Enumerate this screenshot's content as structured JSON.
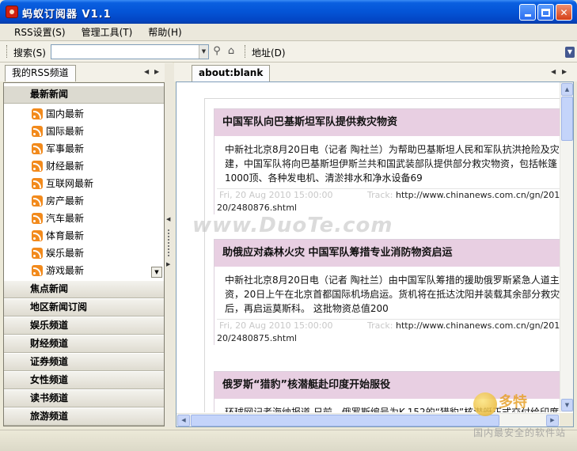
{
  "window": {
    "title": "蚂蚁订阅器  V1.1",
    "controls": {
      "minimize": "minimize",
      "maximize": "maximize",
      "close": "✕"
    }
  },
  "menu": [
    "RSS设置(S)",
    "管理工具(T)",
    "帮助(H)"
  ],
  "toolbar": {
    "search_label": "搜索(S)",
    "search_value": "",
    "address_label": "地址(D)"
  },
  "left_panel": {
    "tab": "我的RSS频道",
    "active_group": "最新新闻",
    "feeds": [
      "国内最新",
      "国际最新",
      "军事最新",
      "财经最新",
      "互联网最新",
      "房产最新",
      "汽车最新",
      "体育最新",
      "娱乐最新",
      "游戏最新"
    ],
    "groups": [
      "焦点新闻",
      "地区新闻订阅",
      "娱乐频道",
      "财经频道",
      "证券频道",
      "女性频道",
      "读书频道",
      "旅游频道"
    ]
  },
  "browser": {
    "tab": "about:blank",
    "articles": [
      {
        "title": "中国军队向巴基斯坦军队提供救灾物资",
        "body": [
          "中新社北京8月20日电（记者 陶社兰）为帮助巴基斯坦人民和军队抗洪抢险及灾后重",
          "建，中国军队将向巴基斯坦伊斯兰共和国武装部队提供部分救灾物资，包括帐篷",
          "1000顶、各种发电机、清淤排水和净水设备69"
        ],
        "meta_date": "Fri, 20 Aug 2010 15:00:00",
        "meta_track": "Track:",
        "link_a": "http://www.chinanews.com.cn/gn/2010/08-",
        "link_b": "20/2480876.shtml"
      },
      {
        "title": "助俄应对森林火灾  中国军队筹措专业消防物资启运",
        "body": [
          "中新社北京8月20日电（记者 陶社兰）由中国军队筹措的援助俄罗斯紧急人道主义物",
          "资，20日上午在北京首都国际机场启运。货机将在抵达沈阳并装载其余部分救灾物资",
          "后，再启运莫斯科。 这批物资总值200"
        ],
        "meta_date": "Fri, 20 Aug 2010 15:00:00",
        "meta_track": "Track:",
        "link_a": "http://www.chinanews.com.cn/gn/2010/08-",
        "link_b": "20/2480875.shtml"
      },
      {
        "title": "俄罗斯“猎豹”核潜艇赴印度开始服役",
        "body": [
          "环球网记者海纳报道 日前，俄罗斯编号为K-152的“猎豹”核潜艇正式交付给印度海军"
        ]
      }
    ]
  },
  "status": "",
  "watermarks": {
    "center": "www.DuoTe.com",
    "corner": "多特",
    "corner_sub": "国内最安全的软件站"
  },
  "icons": {
    "app": "ant-icon",
    "search": "magnifier-icon",
    "home": "home-icon",
    "feed": "rss-icon"
  }
}
